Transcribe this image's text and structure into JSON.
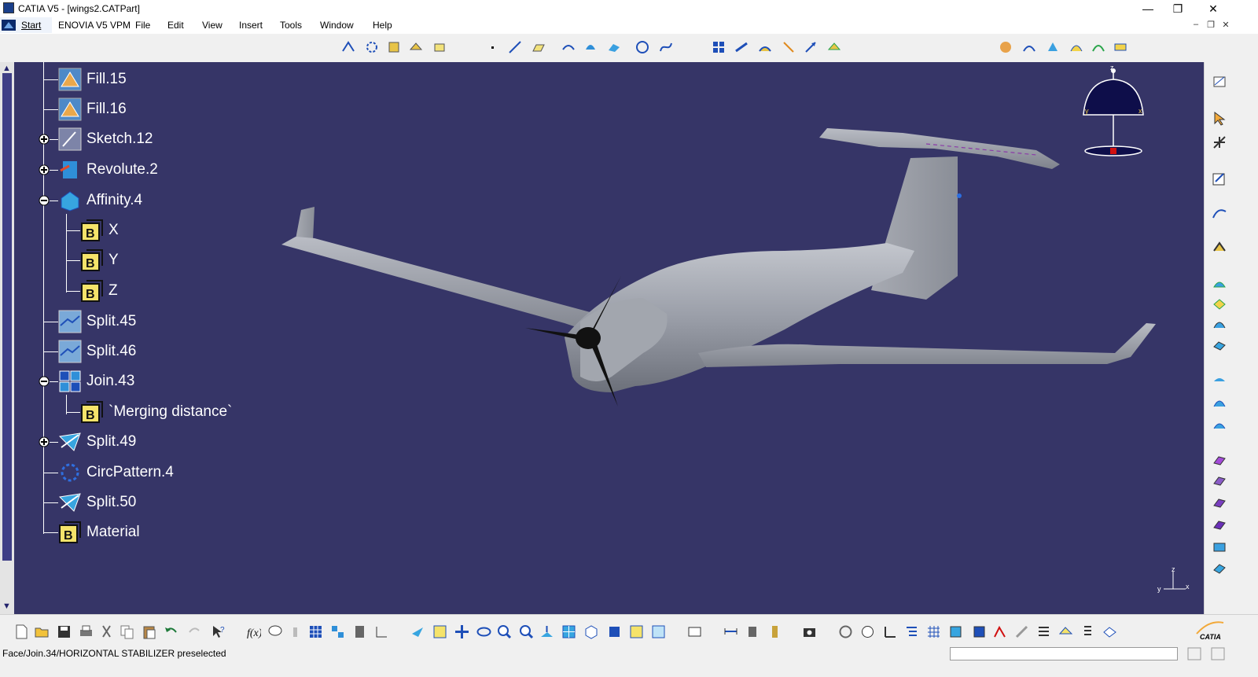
{
  "window": {
    "title": "CATIA V5 - [wings2.CATPart]",
    "minimize": "—",
    "maximize": "❐",
    "close": "✕"
  },
  "menu": {
    "start": "Start",
    "enovia": "ENOVIA V5 VPM",
    "file": "File",
    "edit": "Edit",
    "view": "View",
    "insert": "Insert",
    "tools": "Tools",
    "window": "Window",
    "help": "Help"
  },
  "mdi": {
    "minimize": "–",
    "restore": "❐",
    "close": "✕"
  },
  "tree": {
    "items": [
      {
        "label": "Fill.15",
        "icon": "fill-icon"
      },
      {
        "label": "Fill.16",
        "icon": "fill-icon"
      },
      {
        "label": "Sketch.12",
        "icon": "sketch-icon"
      },
      {
        "label": "Revolute.2",
        "icon": "revolute-icon"
      },
      {
        "label": "Affinity.4",
        "icon": "affinity-icon"
      },
      {
        "label": "X",
        "icon": "parameter-icon"
      },
      {
        "label": "Y",
        "icon": "parameter-icon"
      },
      {
        "label": "Z",
        "icon": "parameter-icon"
      },
      {
        "label": "Split.45",
        "icon": "split-icon"
      },
      {
        "label": "Split.46",
        "icon": "split-icon"
      },
      {
        "label": "Join.43",
        "icon": "join-icon"
      },
      {
        "label": "`Merging distance`",
        "icon": "parameter-icon"
      },
      {
        "label": "Split.49",
        "icon": "split-icon"
      },
      {
        "label": "CircPattern.4",
        "icon": "circpattern-icon"
      },
      {
        "label": "Split.50",
        "icon": "split-icon"
      },
      {
        "label": "Material",
        "icon": "material-icon"
      }
    ]
  },
  "compass": {
    "axis_z": "z",
    "axis_x": "x",
    "axis_y": "y"
  },
  "axis_triad": {
    "z": "z",
    "x": "x",
    "y": "y"
  },
  "status": {
    "message": "Face/Join.34/HORIZONTAL STABILIZER preselected",
    "command_input": ""
  },
  "logo": "CATIA",
  "colors": {
    "viewport_bg": "#363567",
    "tree_text": "#ffffff",
    "model_surface": "#9a9ea8",
    "propeller": "#111111"
  }
}
